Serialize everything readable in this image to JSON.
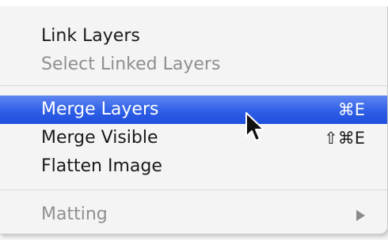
{
  "menu": {
    "items": [
      {
        "label": "Link Layers"
      },
      {
        "label": "Select Linked Layers"
      },
      {
        "label": "Merge Layers",
        "shortcut": "⌘E"
      },
      {
        "label": "Merge Visible",
        "shortcut": "⇧⌘E"
      },
      {
        "label": "Flatten Image"
      },
      {
        "label": "Matting"
      }
    ]
  },
  "colors": {
    "highlight": "#2f5fe6",
    "disabled_text": "#8f8f8f"
  },
  "icons": {
    "cursor": "mouse-pointer-icon",
    "submenu": "submenu-arrow-icon"
  }
}
